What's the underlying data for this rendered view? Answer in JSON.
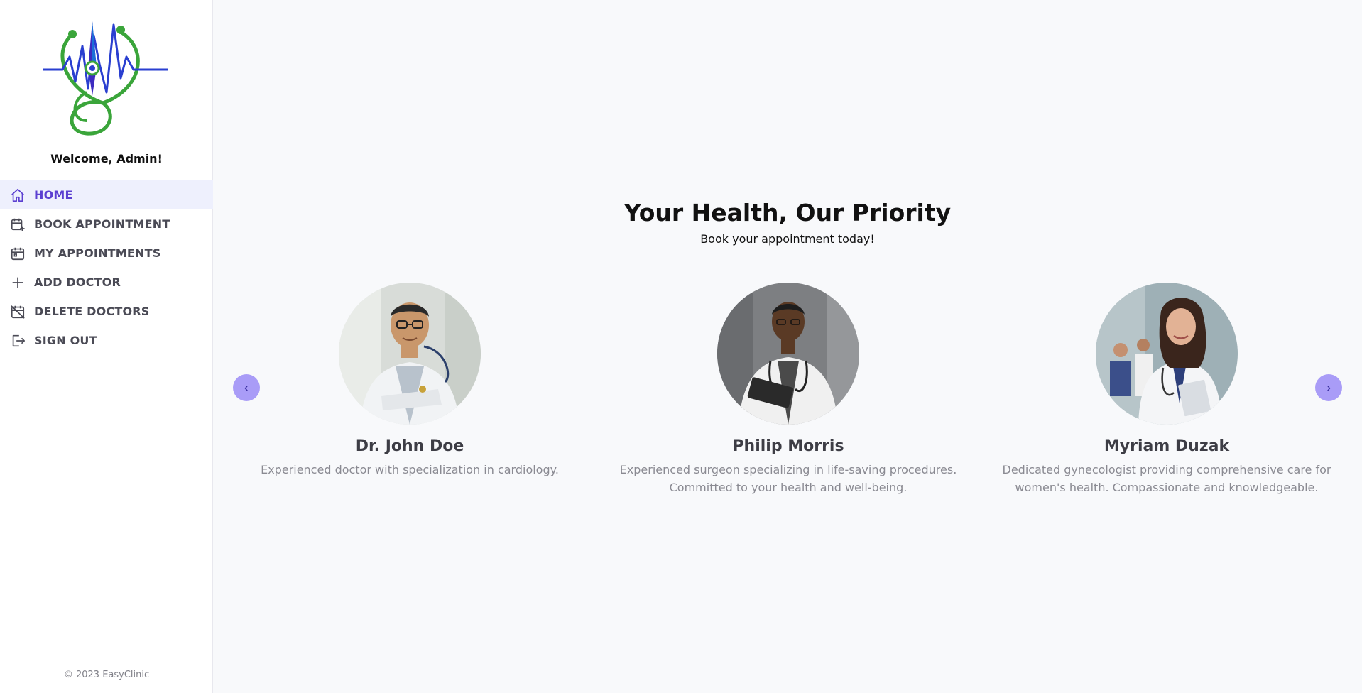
{
  "sidebar": {
    "welcome": "Welcome, Admin!",
    "items": [
      {
        "label": "HOME",
        "icon": "home-icon",
        "active": true
      },
      {
        "label": "BOOK APPOINTMENT",
        "icon": "calendar-plus-icon"
      },
      {
        "label": "MY APPOINTMENTS",
        "icon": "calendar-icon"
      },
      {
        "label": "ADD DOCTOR",
        "icon": "plus-icon"
      },
      {
        "label": "DELETE DOCTORS",
        "icon": "calendar-off-icon"
      },
      {
        "label": "SIGN OUT",
        "icon": "sign-out-icon"
      }
    ],
    "footer": "© 2023 EasyClinic"
  },
  "hero": {
    "title": "Your Health, Our Priority",
    "subtitle": "Book your appointment today!"
  },
  "carousel": {
    "prev": "‹",
    "next": "›",
    "doctors": [
      {
        "name": "Dr. John Doe",
        "description": "Experienced doctor with specialization in cardiology."
      },
      {
        "name": "Philip Morris",
        "description": "Experienced surgeon specializing in life-saving procedures. Committed to your health and well-being."
      },
      {
        "name": "Myriam Duzak",
        "description": "Dedicated gynecologist providing comprehensive care for women's health. Compassionate and knowledgeable."
      }
    ]
  },
  "colors": {
    "accent": "#5b3fd1",
    "active_bg": "#eef0fd",
    "carousel_button": "#a99cf7",
    "logo_green": "#3aa53a",
    "logo_blue": "#2a3fd0"
  }
}
